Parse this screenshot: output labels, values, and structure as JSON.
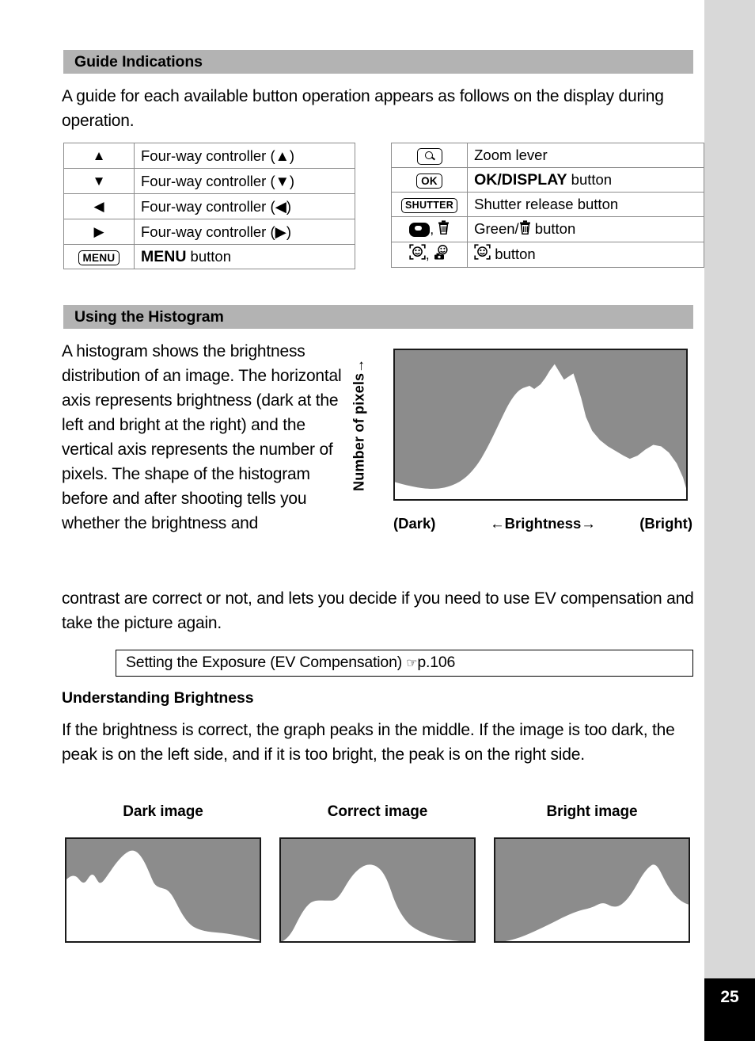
{
  "page": {
    "number": "25",
    "tab_color": "#000000",
    "edge_color": "#d8d8d8",
    "section_header_color": "#b3b3b3",
    "histogram_fill_color": "#8c8c8c"
  },
  "sections": {
    "guide": {
      "title": "Guide Indications",
      "intro": "A guide for each available button operation appears as follows on the display during operation.",
      "table_left": [
        {
          "key": "▲",
          "key_kind": "arrow",
          "desc": "Four-way controller (▲)"
        },
        {
          "key": "▼",
          "key_kind": "arrow",
          "desc": "Four-way controller (▼)"
        },
        {
          "key": "◀",
          "key_kind": "arrow",
          "desc": "Four-way controller (◀)"
        },
        {
          "key": "▶",
          "key_kind": "arrow",
          "desc": "Four-way controller (▶)"
        },
        {
          "key": "MENU",
          "key_kind": "boxed",
          "desc_bold": "MENU",
          "desc_rest": " button"
        }
      ],
      "table_right": [
        {
          "key_icon": "zoom-lever-icon",
          "desc": "Zoom lever"
        },
        {
          "key": "OK",
          "key_kind": "boxed",
          "desc_bold": "OK",
          "desc_sep": "/",
          "desc_bold2": "DISPLAY",
          "desc_rest": " button"
        },
        {
          "key": "SHUTTER",
          "key_kind": "boxed",
          "desc": "Shutter release button"
        },
        {
          "key_icon": "green-button-icon",
          "key_icon2": "trash-icon",
          "desc_pre": "Green/",
          "desc_icon": "trash-icon",
          "desc_rest": " button"
        },
        {
          "key_icon": "face-detect-icon",
          "key_icon2": "self-portrait-icon",
          "desc_icon": "face-detect-icon",
          "desc_rest": " button"
        }
      ]
    },
    "histogram": {
      "title": "Using the Histogram",
      "body_left": "A histogram shows the brightness distribution of an image. The horizontal axis represents brightness (dark at the left and bright at the right) and the vertical axis represents the number of pixels.\nThe shape of the histogram before and after shooting tells you whether the brightness and",
      "body_wide": "contrast are correct or not, and lets you decide if you need to use EV compensation and take the picture again.",
      "axis_y_label": "Number of pixels→",
      "axis_x_left": "(Dark)",
      "axis_x_center": "←Brightness→",
      "axis_x_right": "(Bright)",
      "reference": {
        "text": "Setting the Exposure (EV Compensation) ",
        "pointer_icon": "☞",
        "page_ref": "p.106"
      }
    },
    "understanding": {
      "title": "Understanding Brightness",
      "body": "If the brightness is correct, the graph peaks in the middle. If the image is too dark, the peak is on the left side, and if it is too bright, the peak is on the right side.",
      "examples": [
        {
          "caption": "Dark image"
        },
        {
          "caption": "Correct image"
        },
        {
          "caption": "Bright image"
        }
      ]
    }
  },
  "chart_data": [
    {
      "name": "main-histogram",
      "type": "area",
      "title": "Using the Histogram",
      "xlabel": "←Brightness→",
      "ylabel": "Number of pixels→",
      "xlim": [
        0,
        255
      ],
      "ylim": [
        0,
        100
      ],
      "grid": false,
      "legend": "none",
      "x": [
        0,
        10,
        20,
        30,
        40,
        50,
        60,
        70,
        80,
        90,
        100,
        110,
        120,
        125,
        130,
        135,
        140,
        145,
        150,
        155,
        160,
        170,
        180,
        190,
        200,
        210,
        220,
        230,
        240,
        250,
        255
      ],
      "values": [
        12,
        11,
        9,
        8,
        8,
        9,
        11,
        14,
        26,
        45,
        62,
        72,
        74,
        73,
        78,
        90,
        82,
        80,
        78,
        55,
        40,
        32,
        26,
        23,
        22,
        26,
        30,
        31,
        28,
        20,
        8
      ]
    },
    {
      "name": "dark-image-histogram",
      "type": "area",
      "title": "Dark image",
      "xlim": [
        0,
        255
      ],
      "ylim": [
        0,
        100
      ],
      "grid": false,
      "legend": "none",
      "x": [
        0,
        10,
        20,
        30,
        40,
        50,
        60,
        70,
        80,
        90,
        100,
        110,
        120,
        130,
        140,
        150,
        160,
        170,
        180,
        190,
        200,
        220,
        240,
        255
      ],
      "values": [
        62,
        66,
        60,
        64,
        58,
        62,
        70,
        78,
        86,
        78,
        64,
        56,
        52,
        50,
        40,
        26,
        18,
        14,
        12,
        10,
        8,
        5,
        2,
        0
      ]
    },
    {
      "name": "correct-image-histogram",
      "type": "area",
      "title": "Correct image",
      "xlim": [
        0,
        255
      ],
      "ylim": [
        0,
        100
      ],
      "grid": false,
      "legend": "none",
      "x": [
        0,
        10,
        20,
        30,
        40,
        50,
        60,
        70,
        80,
        90,
        100,
        110,
        120,
        130,
        140,
        150,
        160,
        170,
        180,
        190,
        200,
        220,
        240,
        255
      ],
      "values": [
        2,
        6,
        16,
        34,
        42,
        44,
        44,
        52,
        64,
        76,
        80,
        78,
        70,
        56,
        44,
        36,
        30,
        24,
        18,
        14,
        11,
        7,
        4,
        2
      ]
    },
    {
      "name": "bright-image-histogram",
      "type": "area",
      "title": "Bright image",
      "xlim": [
        0,
        255
      ],
      "ylim": [
        0,
        100
      ],
      "grid": false,
      "legend": "none",
      "x": [
        0,
        10,
        20,
        30,
        40,
        50,
        60,
        70,
        80,
        90,
        100,
        110,
        120,
        130,
        140,
        150,
        160,
        170,
        180,
        190,
        200,
        210,
        220,
        230,
        240,
        250,
        255
      ],
      "values": [
        0,
        2,
        5,
        8,
        11,
        14,
        17,
        21,
        25,
        30,
        36,
        41,
        40,
        42,
        48,
        56,
        66,
        76,
        86,
        82,
        72,
        64,
        58,
        54,
        52,
        52,
        52
      ]
    }
  ]
}
